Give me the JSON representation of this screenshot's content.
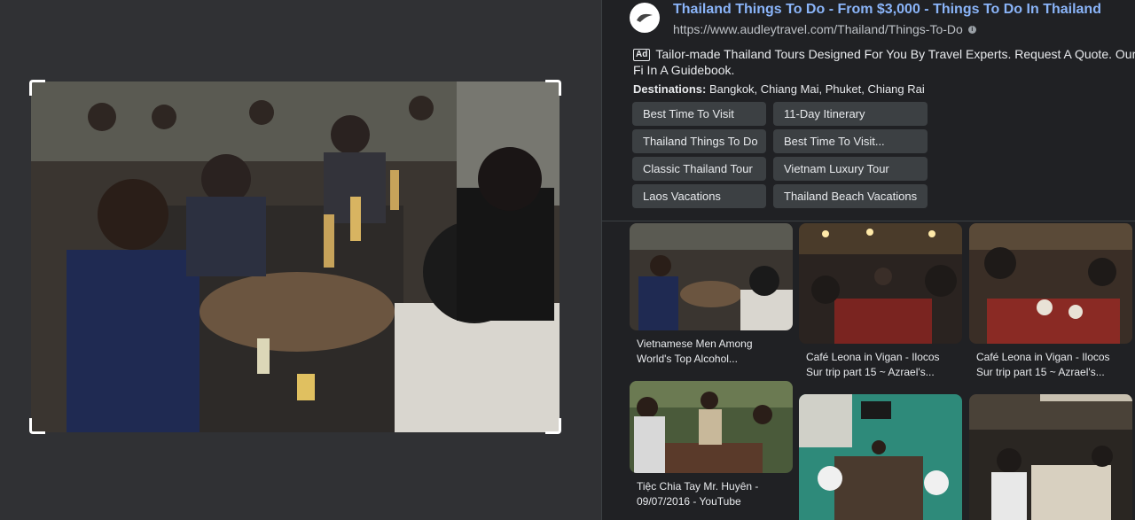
{
  "ad": {
    "favicon": "audley-travel-logo",
    "title": "Thailand Things To Do - From $3,000 - Things To Do In Thailand",
    "url": "https://www.audleytravel.com/Thailand/Things-To-Do",
    "badge": "Ad",
    "description": "Tailor-made Thailand Tours Designed For You By Travel Experts. Request A Quote. Our Fi In A Guidebook.",
    "destinations_label": "Destinations:",
    "destinations_value": " Bangkok, Chiang Mai, Phuket, Chiang Rai",
    "sitelinks": [
      "Best Time To Visit",
      "11-Day Itinerary",
      "Thailand Things To Do",
      "Best Time To Visit...",
      "Classic Thailand Tour",
      "Vietnam Luxury Tour",
      "Laos Vacations",
      "Thailand Beach Vacations"
    ]
  },
  "results": [
    {
      "caption": "Vietnamese Men Among World's Top Alcohol..."
    },
    {
      "caption": "Café Leona in Vigan - Ilocos Sur trip part 15 ~ Azrael's..."
    },
    {
      "caption": "Café Leona in Vigan - Ilocos Sur trip part 15 ~ Azrael's..."
    },
    {
      "caption": "Tiệc Chia Tay Mr. Huyên - 09/07/2016 - YouTube"
    },
    {
      "caption": ""
    },
    {
      "caption": ""
    }
  ],
  "colors": {
    "link": "#8ab4f8",
    "panel": "#303134",
    "background": "#202124",
    "chip": "#3c4043"
  }
}
